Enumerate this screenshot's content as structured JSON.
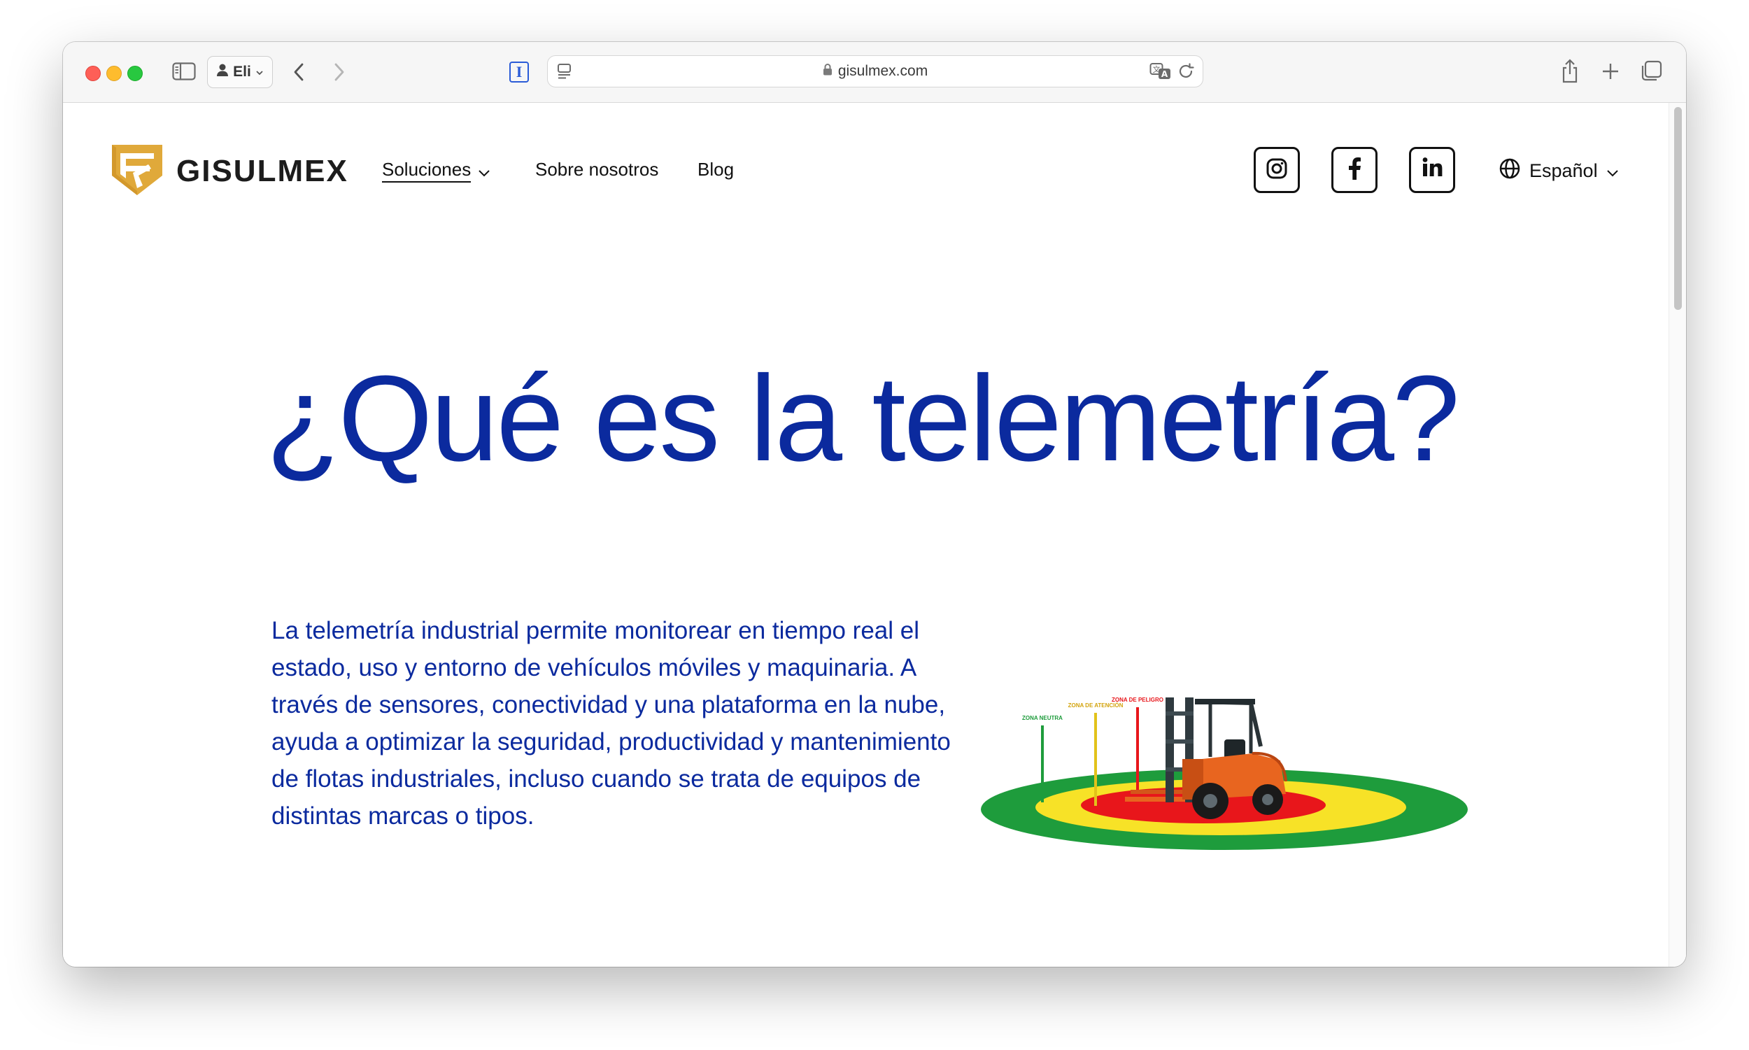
{
  "browser": {
    "profile_name": "Eli",
    "url": "gisulmex.com"
  },
  "site": {
    "brand": "GISULMEX",
    "nav": {
      "solutions": "Soluciones",
      "about": "Sobre nosotros",
      "blog": "Blog"
    },
    "language": "Español",
    "social": [
      "instagram",
      "facebook",
      "linkedin"
    ]
  },
  "hero": {
    "title": "¿Qué es la telemetría?",
    "text": "La telemetría industrial permite monitorear en tiempo real el estado, uso y entorno de vehículos móviles y maquinaria. A través de sensores, conectividad y una plataforma en la nube, ayuda a optimizar la seguridad, productividad y mantenimiento de flotas industriales, incluso cuando se trata de equipos de distintas marcas o tipos."
  },
  "illustration": {
    "zone_labels": [
      "ZONA NEUTRA",
      "ZONA DE ATENCIÓN",
      "ZONA DE PELIGRO"
    ],
    "colors": {
      "neutral": "#1e9c3c",
      "attention": "#f7e227",
      "danger": "#e8161b"
    }
  },
  "colors": {
    "brand_blue": "#0b2a9e",
    "logo_gold": "#e0a93a"
  }
}
